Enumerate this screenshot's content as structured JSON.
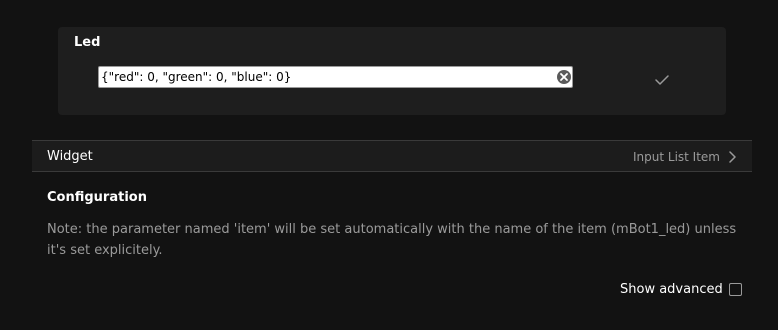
{
  "led": {
    "title": "Led",
    "input_value": "{\"red\": 0, \"green\": 0, \"blue\": 0}"
  },
  "widget": {
    "label": "Widget",
    "value": "Input List Item"
  },
  "configuration": {
    "title": "Configuration",
    "note": "Note: the parameter named 'item' will be set automatically with the name of the item (mBot1_led) unless it's set explicitely."
  },
  "advanced": {
    "label": "Show advanced",
    "checked": false
  }
}
